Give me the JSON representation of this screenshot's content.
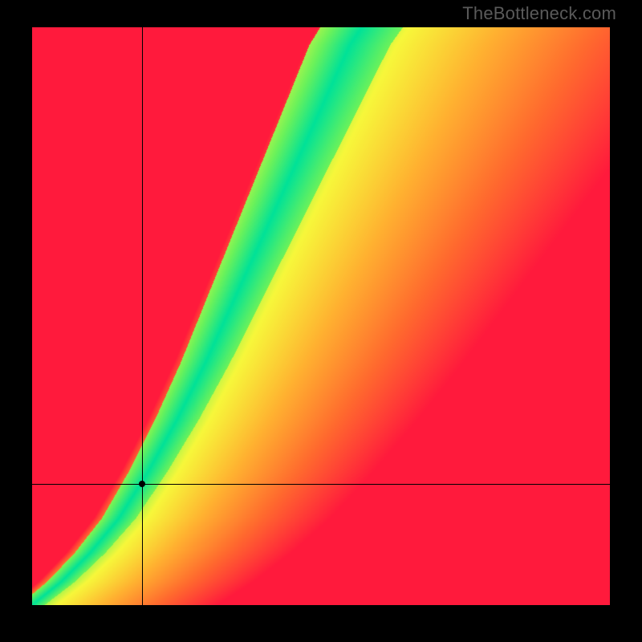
{
  "watermark": "TheBottleneck.com",
  "chart_data": {
    "type": "heatmap",
    "title": "",
    "xlabel": "",
    "ylabel": "",
    "xlim": [
      0,
      100
    ],
    "ylim": [
      0,
      100
    ],
    "ridge": [
      {
        "x": 0,
        "y": 0
      },
      {
        "x": 5,
        "y": 4
      },
      {
        "x": 10,
        "y": 9
      },
      {
        "x": 15,
        "y": 15
      },
      {
        "x": 20,
        "y": 23
      },
      {
        "x": 25,
        "y": 32
      },
      {
        "x": 30,
        "y": 42
      },
      {
        "x": 35,
        "y": 53
      },
      {
        "x": 40,
        "y": 64
      },
      {
        "x": 45,
        "y": 75
      },
      {
        "x": 50,
        "y": 86
      },
      {
        "x": 55,
        "y": 97
      },
      {
        "x": 57,
        "y": 100
      }
    ],
    "ridge_width_frac": 0.055,
    "marker": {
      "x": 19,
      "y": 21
    },
    "crosshair": {
      "x": 19,
      "y": 21
    },
    "color_stops": [
      {
        "t": 0.0,
        "color": "#00e298"
      },
      {
        "t": 0.1,
        "color": "#6cf25a"
      },
      {
        "t": 0.22,
        "color": "#f7f73a"
      },
      {
        "t": 0.45,
        "color": "#ffb030"
      },
      {
        "t": 0.7,
        "color": "#ff6a2e"
      },
      {
        "t": 1.0,
        "color": "#ff1a3c"
      }
    ]
  }
}
